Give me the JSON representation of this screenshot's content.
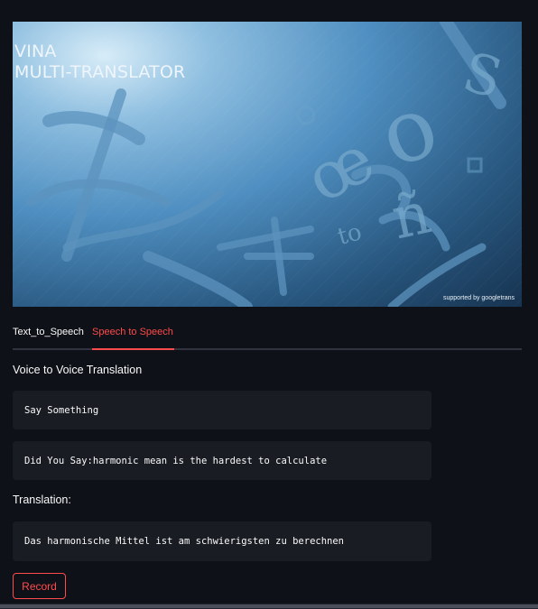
{
  "banner": {
    "title_line1": "VINA",
    "title_line2": "MULTI-TRANSLATOR",
    "credit": "supported by googletrans"
  },
  "tabs": [
    {
      "label": "Text_to_Speech",
      "active": false
    },
    {
      "label": "Speech to Speech",
      "active": true
    }
  ],
  "section_heading": "Voice to Voice Translation",
  "prompt_box": "Say Something",
  "recognized_box": "Did You Say:harmonic mean is the hardest to calculate",
  "translation_heading": "Translation:",
  "translation_box": "Das harmonische Mittel ist am schwierigsten zu berechnen",
  "record_button": "Record",
  "colors": {
    "background": "#0e1117",
    "accent": "#ff4b4b",
    "code_background": "#1a1c24"
  }
}
